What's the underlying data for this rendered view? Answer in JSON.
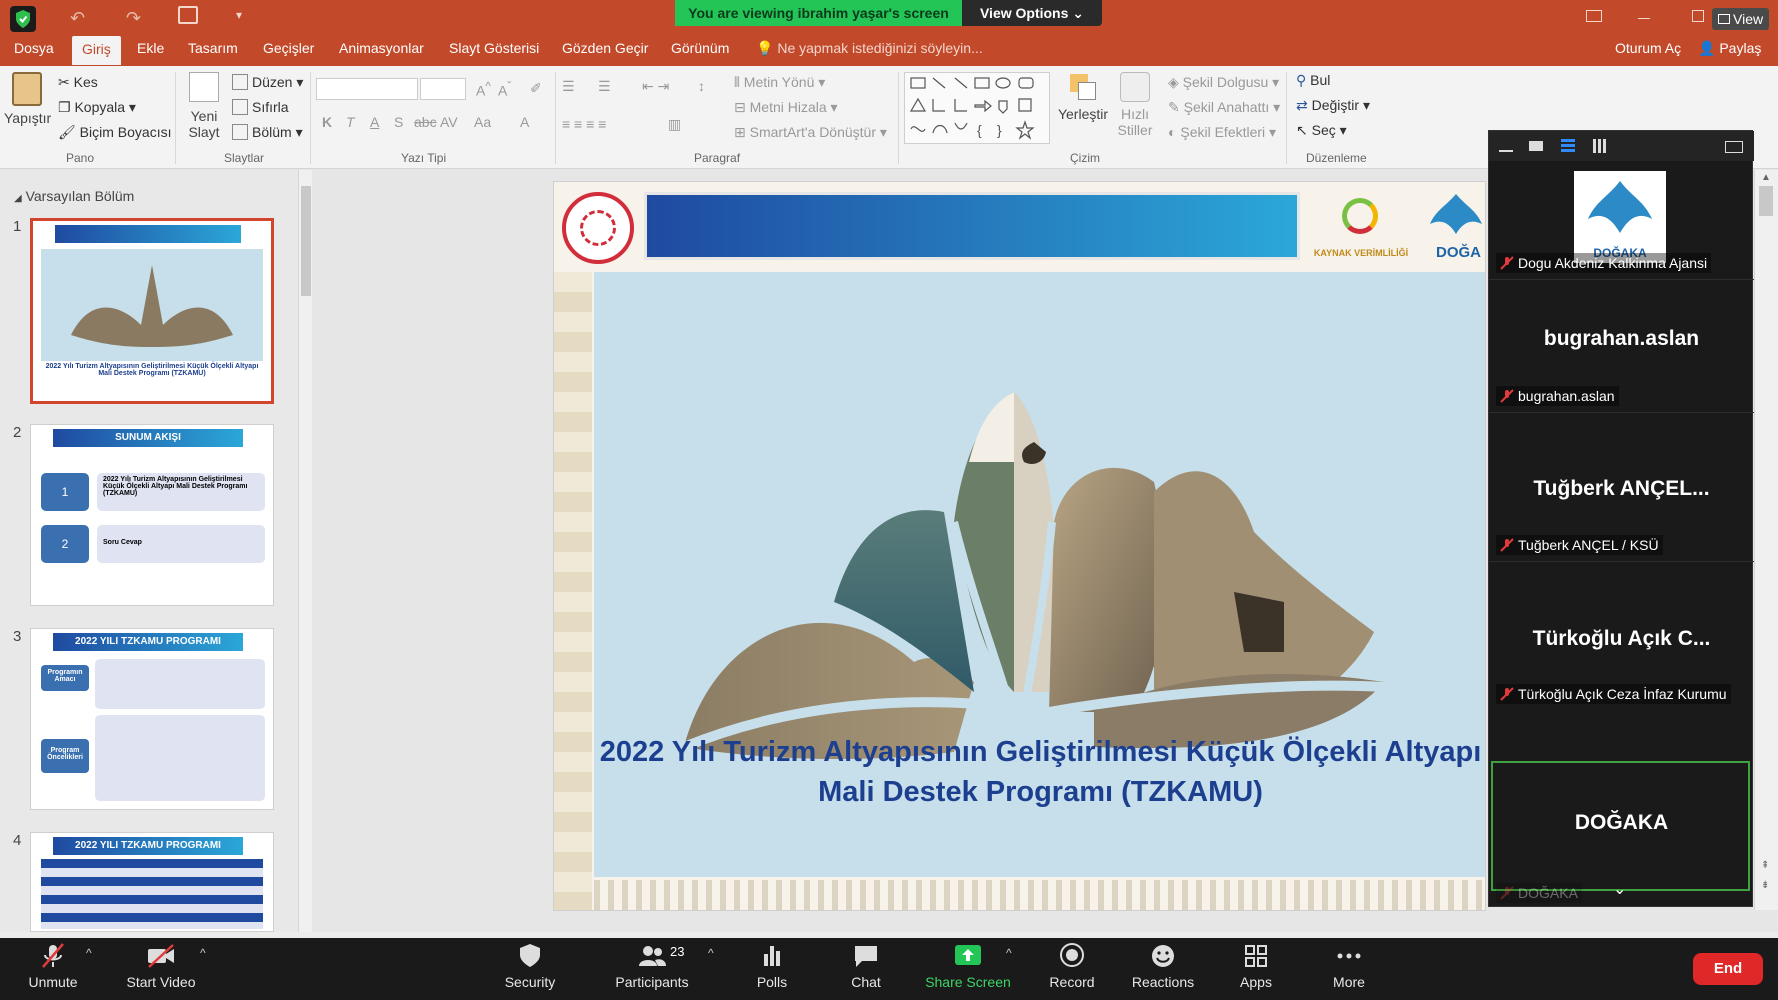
{
  "share_banner": {
    "status": "You are viewing ibrahim yaşar's screen",
    "view_options": "View Options"
  },
  "titlebar": {
    "view_label": "View"
  },
  "tabs": [
    "Dosya",
    "Giriş",
    "Ekle",
    "Tasarım",
    "Geçişler",
    "Animasyonlar",
    "Slayt Gösterisi",
    "Gözden Geçir",
    "Görünüm"
  ],
  "tell_me": "Ne yapmak istediğinizi söyleyin...",
  "account": {
    "sign_in": "Oturum Aç",
    "share": "Paylaş"
  },
  "ribbon": {
    "pano": {
      "paste": "Yapıştır",
      "cut": "Kes",
      "copy": "Kopyala",
      "format_painter": "Biçim Boyacısı",
      "label": "Pano"
    },
    "slaytlar": {
      "new_slide_1": "Yeni",
      "new_slide_2": "Slayt",
      "layout": "Düzen",
      "reset": "Sıfırla",
      "section": "Bölüm",
      "label": "Slaytlar"
    },
    "yazi_tipi": {
      "bold": "K",
      "italic": "T",
      "underline": "A",
      "shadow": "S",
      "strike": "abc",
      "spacing": "AV",
      "case": "Aa",
      "color": "A",
      "label": "Yazı Tipi"
    },
    "paragraf": {
      "text_direction": "Metin Yönü",
      "align_text": "Metni Hizala",
      "smartart": "SmartArt'a Dönüştür",
      "label": "Paragraf"
    },
    "cizim": {
      "arrange": "Yerleştir",
      "quick_styles_1": "Hızlı",
      "quick_styles_2": "Stiller",
      "shape_fill": "Şekil Dolgusu",
      "shape_outline": "Şekil Anahattı",
      "shape_effects": "Şekil Efektleri",
      "label": "Çizim"
    },
    "duzenleme": {
      "find": "Bul",
      "replace": "Değiştir",
      "select": "Seç",
      "label": "Düzenleme"
    }
  },
  "slide_panel": {
    "section": "Varsayılan Bölüm",
    "slides": [
      {
        "number": "1",
        "caption_1": "2022 Yılı Turizm Altyapısının Geliştirilmesi Küçük Ölçekli Altyapı",
        "caption_2": "Mali Destek Programı (TZKAMU)"
      },
      {
        "number": "2",
        "title": "SUNUM AKIŞI",
        "item1_num": "1",
        "item1": "2022 Yılı Turizm Altyapısının Geliştirilmesi Küçük Ölçekli Altyapı Mali Destek Programı (TZKAMU)",
        "item2_num": "2",
        "item2": "Soru Cevap"
      },
      {
        "number": "3",
        "title": "2022 YILI TZKAMU PROGRAMI",
        "box1": "Programın Amacı",
        "box2": "Program Öncelikleri"
      },
      {
        "number": "4",
        "title": "2022 YILI TZKAMU PROGRAMI"
      }
    ]
  },
  "slide": {
    "logo_text": "KAYNAK VERİMLİLİĞİ",
    "logo_text_2": "DOĞA",
    "title_line1": "2022 Yılı Turizm Altyapısının Geliştirilmesi Küçük Ölçekli Altyapı",
    "title_line2": "Mali Destek Programı (TZKAMU)"
  },
  "participants_panel": {
    "tiles": [
      {
        "name_display": "",
        "label": "Dogu Akdeniz Kalkinma Ajansi",
        "logo_text": "DOĞAKA"
      },
      {
        "name_display": "bugrahan.aslan",
        "label": "bugrahan.aslan"
      },
      {
        "name_display": "Tuğberk ANÇEL...",
        "label": "Tuğberk ANÇEL / KSÜ"
      },
      {
        "name_display": "Türkoğlu Açık C...",
        "label": "Türkoğlu Açık Ceza İnfaz Kurumu"
      },
      {
        "name_display": "DOĞAKA",
        "label": "DOĞAKA"
      }
    ]
  },
  "toolbar": {
    "unmute": "Unmute",
    "start_video": "Start Video",
    "security": "Security",
    "participants": "Participants",
    "participants_count": "23",
    "polls": "Polls",
    "chat": "Chat",
    "share_screen": "Share Screen",
    "record": "Record",
    "reactions": "Reactions",
    "apps": "Apps",
    "more": "More",
    "end": "End"
  },
  "colors": {
    "office_accent": "#c24a2b",
    "share_green": "#23c556",
    "end_red": "#e02828",
    "slide_title": "#1d3f8f"
  }
}
